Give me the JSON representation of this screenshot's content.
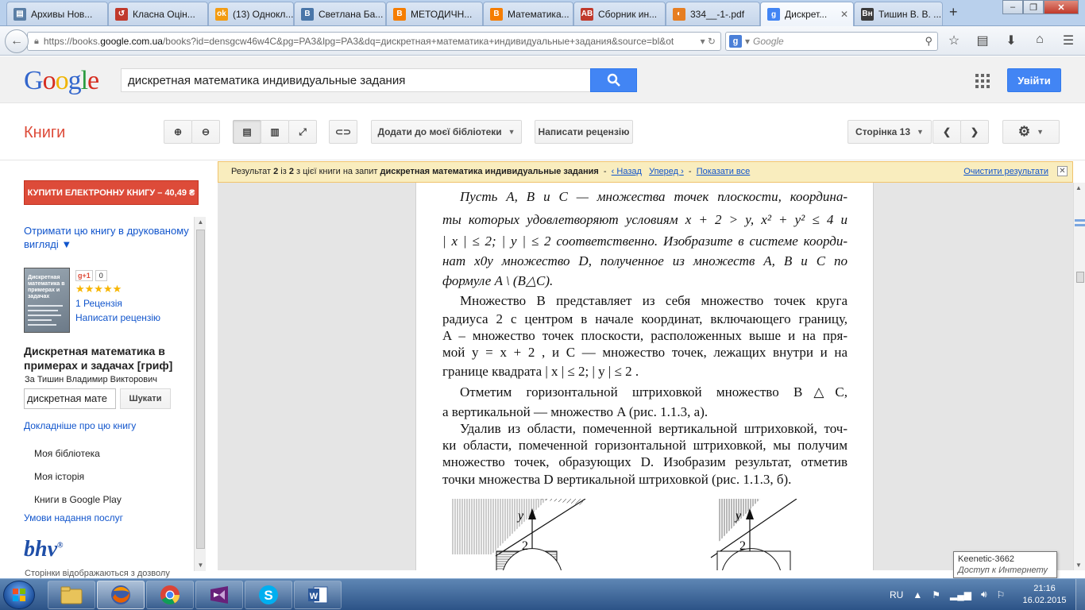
{
  "browser": {
    "tabs": [
      {
        "label": "Архивы Нов...",
        "icon_color": "#5b7fa6",
        "icon_glyph": "▤"
      },
      {
        "label": "Класна Оцін...",
        "icon_color": "#c0392b",
        "icon_glyph": "↺"
      },
      {
        "label": "(13) Однокл...",
        "icon_color": "#f39c12",
        "icon_glyph": "ok"
      },
      {
        "label": "Светлана Ба...",
        "icon_color": "#4a76a8",
        "icon_glyph": "B"
      },
      {
        "label": "МЕТОДИЧН...",
        "icon_color": "#f57d00",
        "icon_glyph": "B"
      },
      {
        "label": "Математика...",
        "icon_color": "#f57d00",
        "icon_glyph": "B"
      },
      {
        "label": "Сборник ин...",
        "icon_color": "#c0392b",
        "icon_glyph": "AB"
      },
      {
        "label": "334__-1-.pdf",
        "icon_color": "#e67e22",
        "icon_glyph": "◐"
      },
      {
        "label": "Дискрет...",
        "icon_color": "#4285f4",
        "icon_glyph": "g"
      },
      {
        "label": "Тишин В. В. ...",
        "icon_color": "#3b3b3b",
        "icon_glyph": "Вн"
      }
    ],
    "url_prefix": "https://books.",
    "url_host": "google.com.ua",
    "url_rest": "/books?id=densgcw46w4C&pg=PA3&lpg=PA3&dq=дискретная+математика+индивидуальные+задания&source=bl&ot",
    "search_placeholder": "Google"
  },
  "google": {
    "search_value": "дискретная математика индивидуальные задания",
    "signin_label": "Увійти"
  },
  "books": {
    "title": "Книги",
    "add_library_label": "Додати до моєї бібліотеки",
    "write_review_label": "Написати рецензію",
    "page_label": "Сторінка 13"
  },
  "result_bar": {
    "prefix": "Результат",
    "num": "2",
    "of": "із",
    "total": "2",
    "mid": "з цієї книги на запит",
    "query": "дискретная математика индивидуальные задания",
    "back": "‹ Назад",
    "forward": "Уперед ›",
    "show_all": "Показати все",
    "clear": "Очистити результати"
  },
  "sidebar": {
    "buy_label": "КУПИТИ ЕЛЕКТРОННУ КНИГУ – 40,49 ₴",
    "print_link": "Отримати цю книгу в друкованому вигляді ▼",
    "gplus_label": "g+1",
    "gplus_count": "0",
    "stars": "★★★★★",
    "review_count": "1 Рецензія",
    "write_review": "Написати рецензію",
    "book_title": "Дискретная математика в примерах и задачах [гриф]",
    "author": "За Тишин Владимир Викторович",
    "search_value": "дискретная мате",
    "search_button": "Шукати",
    "more_about": "Докладніше про цю книгу",
    "my_library": "Моя бібліотека",
    "my_history": "Моя історія",
    "play_books": "Книги в Google Play",
    "terms": "Умови надання послуг",
    "publisher_logo": "bhv",
    "publisher_mark": "®",
    "permission_note": "Сторінки відображаються з дозволу",
    "cover_title": "Дискретная математика в примерах и задачах"
  },
  "page": {
    "lines": [
      "Пусть  A,  B  и  C  — множества точек плоскости, координа-",
      "ты  которых  удовлетворяют  условиям   x + 2 > y,   x² + y² ≤ 4   и",
      "| x | ≤ 2;   | y | ≤ 2  соответственно. Изобразите в системе коорди-",
      "нат  x0y  множество  D,  полученное из множеств  A, B  и  C по",
      "формуле   A \\ (B△C).",
      "Множество  B  представляет из себя множество точек круга",
      "радиуса 2 с центром в начале координат, включающего границу,",
      "A  – множество точек плоскости, расположенных выше и на пря-",
      "мой   y = x + 2 ,  и  C   —  множество  точек,  лежащих  внутри  и  на",
      "границе квадрата  | x | ≤ 2;   | y | ≤ 2 .",
      "Отметим  горизонтальной  штриховкой  множество    B△C,",
      "а вертикальной — множество  A  (рис. 1.1.3, а).",
      "Удалив из области, помеченной вертикальной штриховкой, точ-",
      "ки области, помеченной горизонтальной штриховкой, мы получим",
      "множество точек, образующих  D. Изобразим результат, отметив",
      "точки множества  D  вертикальной штриховкой (рис. 1.1.3, б)."
    ],
    "fig_axis_label": "y",
    "fig_tick_label": "2"
  },
  "tooltip": {
    "line1": "Keenetic-3662",
    "line2": "Доступ к Интернету"
  },
  "taskbar": {
    "lang": "RU",
    "time": "21:16",
    "date": "16.02.2015"
  }
}
